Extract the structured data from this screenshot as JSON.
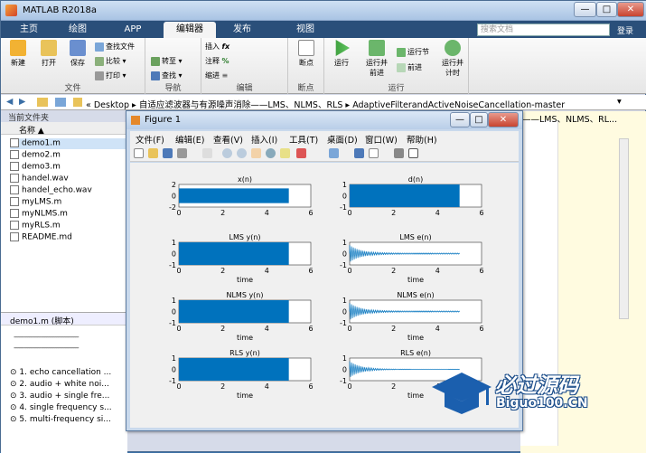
{
  "app": {
    "title": "MATLAB R2018a"
  },
  "window_controls": {
    "minimize": "—",
    "maximize": "□",
    "close": "✕"
  },
  "tabs": [
    "主页",
    "绘图",
    "APP",
    "编辑器",
    "发布",
    "视图"
  ],
  "search": {
    "placeholder": "搜索文档"
  },
  "login_label": "登录",
  "ribbon": {
    "file": {
      "caption": "文件",
      "new": "新建",
      "open": "打开",
      "save": "保存",
      "find_files": "查找文件",
      "compare": "比较",
      "print": "打印"
    },
    "nav": {
      "caption": "导航",
      "goto": "转至",
      "find": "查找"
    },
    "edit": {
      "caption": "编辑",
      "insert": "插入",
      "comment": "注释",
      "indent": "缩进"
    },
    "breakpoints": {
      "caption": "断点",
      "breakpoints": "断点"
    },
    "run": {
      "caption": "运行",
      "run": "运行",
      "run_advance": "运行并\n前进",
      "run_section": "运行节",
      "advance": "前进",
      "run_time": "运行并\n计时"
    }
  },
  "address": {
    "path": "«  Desktop  ▸  自适应滤波器与有源噪声消除——LMS、NLMS、RLS  ▸  AdaptiveFilterandActiveNoiseCancellation-master",
    "right_path": "——LMS、NLMS、RL..."
  },
  "file_browser": {
    "header": "当前文件夹",
    "column": "名称 ▲",
    "files": [
      "demo1.m",
      "demo2.m",
      "demo3.m",
      "handel.wav",
      "handel_echo.wav",
      "myLMS.m",
      "myNLMS.m",
      "myRLS.m",
      "README.md"
    ]
  },
  "details": {
    "header": "demo1.m  (脚本)",
    "dash_line": "--------------------------------------",
    "items": [
      "1.  echo cancellation ...",
      "2.  audio + white noi...",
      "3.  audio + single fre...",
      "4.  single frequency s...",
      "5.  multi-frequency si..."
    ]
  },
  "figure": {
    "title": "Figure 1",
    "menu": [
      "文件(F)",
      "编辑(E)",
      "查看(V)",
      "插入(I)",
      "工具(T)",
      "桌面(D)",
      "窗口(W)",
      "帮助(H)"
    ]
  },
  "chart_data": [
    {
      "type": "line",
      "title": "x(n)",
      "xlabel": "",
      "ylabel": "",
      "xlim": [
        0,
        6
      ],
      "ylim": [
        -2,
        2
      ],
      "yticks": [
        -2,
        0,
        2
      ],
      "xticks": [
        0,
        2,
        4,
        6
      ],
      "series": [
        {
          "x": [
            0,
            5
          ],
          "y_min": -1.3,
          "y_max": 1.3
        }
      ]
    },
    {
      "type": "line",
      "title": "d(n)",
      "xlabel": "",
      "ylabel": "",
      "xlim": [
        0,
        6
      ],
      "ylim": [
        -1,
        1
      ],
      "yticks": [
        -1,
        0,
        1
      ],
      "xticks": [
        0,
        2,
        4,
        6
      ],
      "series": [
        {
          "x": [
            0,
            5
          ],
          "y_min": -1,
          "y_max": 1
        }
      ]
    },
    {
      "type": "line",
      "title": "LMS y(n)",
      "xlabel": "time",
      "ylabel": "",
      "xlim": [
        0,
        6
      ],
      "ylim": [
        -1,
        1
      ],
      "yticks": [
        -1,
        0,
        1
      ],
      "xticks": [
        0,
        2,
        4,
        6
      ],
      "series": [
        {
          "x": [
            0,
            5
          ],
          "y_min": -1,
          "y_max": 1
        }
      ]
    },
    {
      "type": "line",
      "title": "LMS e(n)",
      "xlabel": "time",
      "ylabel": "",
      "xlim": [
        0,
        6
      ],
      "ylim": [
        -1,
        1
      ],
      "yticks": [
        -1,
        0,
        1
      ],
      "xticks": [
        0,
        2,
        4,
        6
      ],
      "series": [
        {
          "x": [
            0,
            5
          ],
          "y_min": -0.05,
          "y_max": 0.05
        }
      ]
    },
    {
      "type": "line",
      "title": "NLMS y(n)",
      "xlabel": "time",
      "ylabel": "",
      "xlim": [
        0,
        6
      ],
      "ylim": [
        -1,
        1
      ],
      "yticks": [
        -1,
        0,
        1
      ],
      "xticks": [
        0,
        2,
        4,
        6
      ],
      "series": [
        {
          "x": [
            0,
            5
          ],
          "y_min": -1,
          "y_max": 1
        }
      ]
    },
    {
      "type": "line",
      "title": "NLMS e(n)",
      "xlabel": "time",
      "ylabel": "",
      "xlim": [
        0,
        6
      ],
      "ylim": [
        -1,
        1
      ],
      "yticks": [
        -1,
        0,
        1
      ],
      "xticks": [
        0,
        2,
        4,
        6
      ],
      "series": [
        {
          "x": [
            0,
            5
          ],
          "y_min": -0.05,
          "y_max": 0.05
        }
      ]
    },
    {
      "type": "line",
      "title": "RLS y(n)",
      "xlabel": "time",
      "ylabel": "",
      "xlim": [
        0,
        6
      ],
      "ylim": [
        -1,
        1
      ],
      "yticks": [
        -1,
        0,
        1
      ],
      "xticks": [
        0,
        2,
        4,
        6
      ],
      "series": [
        {
          "x": [
            0,
            5
          ],
          "y_min": -1,
          "y_max": 1
        }
      ]
    },
    {
      "type": "line",
      "title": "RLS e(n)",
      "xlabel": "time",
      "ylabel": "",
      "xlim": [
        0,
        6
      ],
      "ylim": [
        -1,
        1
      ],
      "yticks": [
        -1,
        0,
        1
      ],
      "xticks": [
        0,
        2,
        4,
        6
      ],
      "series": [
        {
          "x": [
            0,
            5
          ],
          "y_min": -0.02,
          "y_max": 0.02
        }
      ]
    }
  ],
  "watermark": {
    "line1": "必过源码",
    "line2": "Biguo100.CN"
  },
  "colors": {
    "signal": "#0072bd",
    "tab_bar": "#2a4f7a"
  }
}
